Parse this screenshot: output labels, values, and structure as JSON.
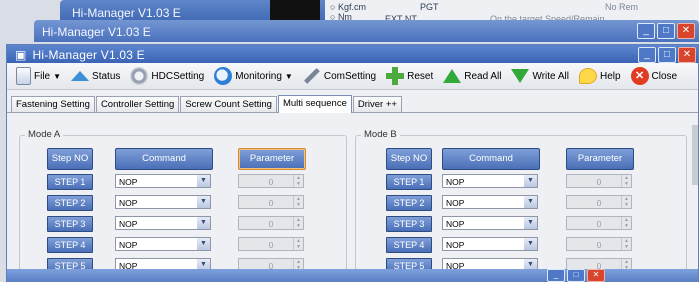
{
  "bg_windows": {
    "w3": {
      "title": "Hi-Manager V1.03 E",
      "radio_options": [
        "Kgf.cm",
        "Nm"
      ],
      "hint": "On the target Speed/Remain",
      "extra": "EXT NT",
      "col": "PGT",
      "col2": "No Rem"
    },
    "w2": {
      "title": "Hi-Manager V1.03 E"
    }
  },
  "window": {
    "title": "Hi-Manager  V1.03 E"
  },
  "toolbar": {
    "file": "File",
    "status": "Status",
    "hdc": "HDCSetting",
    "monitoring": "Monitoring",
    "com": "ComSetting",
    "reset": "Reset",
    "read_all": "Read All",
    "write_all": "Write All",
    "help": "Help",
    "close": "Close"
  },
  "tabs": [
    "Fastening Setting",
    "Controller Setting",
    "Screw Count Setting",
    "Multi sequence",
    "Driver ++"
  ],
  "active_tab": 3,
  "mode_a": {
    "label": "Mode A",
    "headers": {
      "step": "Step NO",
      "command": "Command",
      "parameter": "Parameter"
    },
    "rows": [
      {
        "step": "STEP 1",
        "command": "NOP",
        "param": "0"
      },
      {
        "step": "STEP 2",
        "command": "NOP",
        "param": "0"
      },
      {
        "step": "STEP 3",
        "command": "NOP",
        "param": "0"
      },
      {
        "step": "STEP 4",
        "command": "NOP",
        "param": "0"
      },
      {
        "step": "STEP 5",
        "command": "NOP",
        "param": "0"
      }
    ]
  },
  "mode_b": {
    "label": "Mode B",
    "headers": {
      "step": "Step NO",
      "command": "Command",
      "parameter": "Parameter"
    },
    "rows": [
      {
        "step": "STEP 1",
        "command": "NOP",
        "param": "0"
      },
      {
        "step": "STEP 2",
        "command": "NOP",
        "param": "0"
      },
      {
        "step": "STEP 3",
        "command": "NOP",
        "param": "0"
      },
      {
        "step": "STEP 4",
        "command": "NOP",
        "param": "0"
      },
      {
        "step": "STEP 5",
        "command": "NOP",
        "param": "0"
      }
    ]
  }
}
